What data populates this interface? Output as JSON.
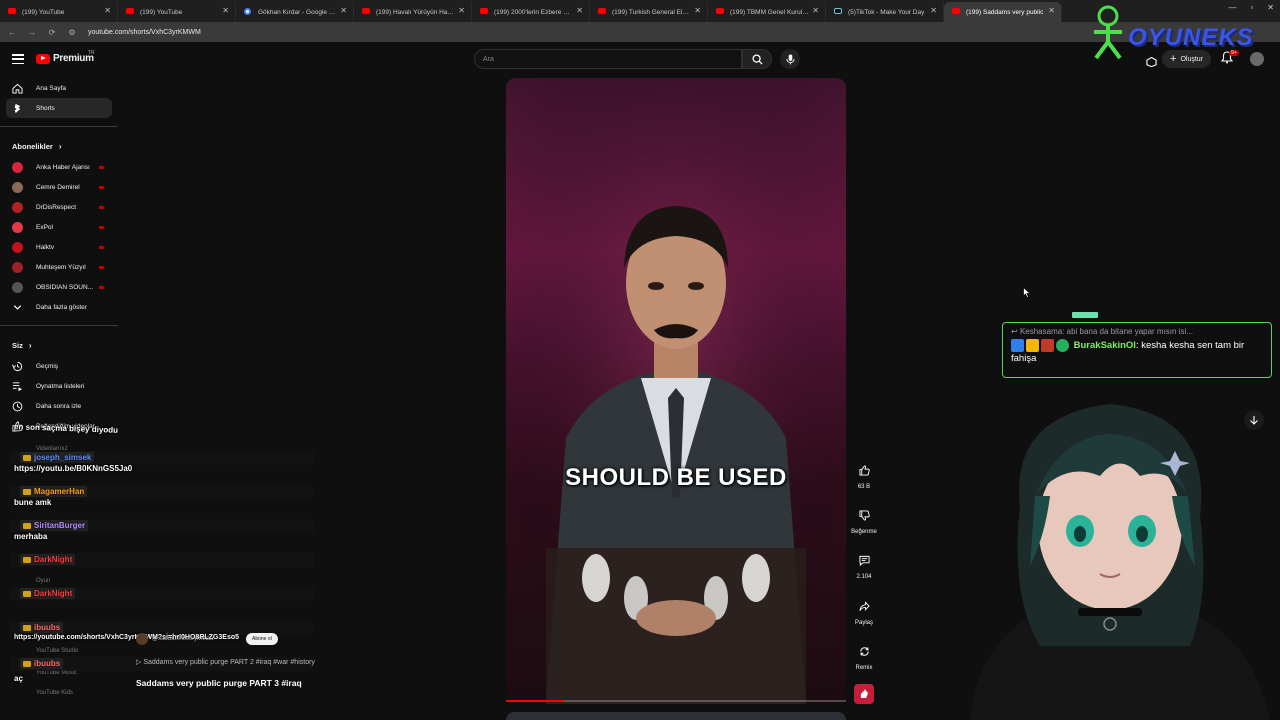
{
  "browser": {
    "tabs": [
      {
        "title": "(199) YouTube",
        "favicon": "yt"
      },
      {
        "title": "(199) YouTube",
        "favicon": "yt"
      },
      {
        "title": "Gökhan Kırdar - Google Search",
        "favicon": "google"
      },
      {
        "title": "(199) Havalı Yürüyün Havalı, Ka",
        "favicon": "yt"
      },
      {
        "title": "(199) 2000'lerin Ezbere Bilinen",
        "favicon": "yt"
      },
      {
        "title": "(199) Turkish General Election",
        "favicon": "yt"
      },
      {
        "title": "(199) TBMM Genel Kurulu 2024",
        "favicon": "yt"
      },
      {
        "title": "(5)TikTok - Make Your Day",
        "favicon": "tiktok"
      },
      {
        "title": "(199) Saddams very public",
        "favicon": "yt",
        "active": true
      }
    ],
    "url": "youtube.com/shorts/VxhC3yrKMWM"
  },
  "header": {
    "logo_text": "Premium",
    "logo_sup": "TR",
    "search_placeholder": "Ara",
    "create_label": "Oluştur",
    "notif_count": "9+"
  },
  "sidebar": {
    "main": [
      {
        "label": "Ana Sayfa",
        "icon": "home-icon"
      },
      {
        "label": "Shorts",
        "icon": "shorts-icon",
        "active": true
      }
    ],
    "subs_header": "Abonelikler",
    "subscriptions": [
      {
        "label": "Anka Haber Ajansı",
        "color": "#d7263d"
      },
      {
        "label": "Cemre Demirel",
        "color": "#8a6a5a"
      },
      {
        "label": "DrDisRespect",
        "color": "#b22222"
      },
      {
        "label": "ExPol",
        "color": "#e63946"
      },
      {
        "label": "Halktv",
        "color": "#c1121f"
      },
      {
        "label": "Muhteşem Yüzyıl",
        "color": "#9b2226"
      },
      {
        "label": "OBSIDIAN SOUN...",
        "color": "#555555"
      }
    ],
    "show_more": "Daha fazla göster",
    "you_header": "Siz",
    "you_items": [
      {
        "label": "Geçmiş",
        "icon": "history-icon"
      },
      {
        "label": "Oynatma listeleri",
        "icon": "playlist-icon"
      },
      {
        "label": "Daha sonra izle",
        "icon": "clock-icon"
      },
      {
        "label": "Beğendiğim videolar",
        "icon": "like-icon"
      }
    ]
  },
  "chat_overlay": {
    "messages": [
      {
        "type": "msg",
        "text": "en son saçma bişey diyodu"
      },
      {
        "type": "name",
        "text": "joseph_simsek",
        "color": "#5b8cff"
      },
      {
        "type": "msg",
        "text": "https://youtu.be/B0KNnGS5Ja0"
      },
      {
        "type": "name",
        "text": "MagamerHan",
        "color": "#ff9f1c"
      },
      {
        "type": "msg",
        "text": "bune amk"
      },
      {
        "type": "name",
        "text": "SiritanBurger",
        "color": "#b48cff"
      },
      {
        "type": "msg",
        "text": "merhaba"
      },
      {
        "type": "name",
        "text": "DarkNight",
        "color": "#ff3b3b"
      },
      {
        "type": "name",
        "text": "DarkNight",
        "color": "#ff3b3b"
      },
      {
        "type": "name",
        "text": "ibuubs",
        "color": "#ff6b6b"
      },
      {
        "type": "msg",
        "text": "https://youtube.com/shorts/VxhC3yrKMWM?si=hrI0HO8RLZG3Eso5"
      },
      {
        "type": "name",
        "text": "ibuubs",
        "color": "#ff6b6b"
      },
      {
        "type": "msg",
        "text": "aç"
      }
    ],
    "ghost": [
      "Videolarınız",
      "Oyun",
      "daha fazla",
      "YouTube Studio",
      "YouTube Music",
      "YouTube Kids"
    ]
  },
  "short": {
    "channel": "@saddamhistorymedia",
    "subscribe_label": "Abone ol",
    "subtitle": "Saddams very public purge PART 2 #iraq #war #history",
    "title": "Saddams very public purge PART 3 #iraq",
    "caption": "SHOULD BE USED",
    "progress_fraction": 0.17
  },
  "actions": [
    {
      "name": "like",
      "label": "63 B",
      "icon": "thumbs-up-icon"
    },
    {
      "name": "dislike",
      "label": "Beğenme",
      "icon": "thumbs-down-icon"
    },
    {
      "name": "comments",
      "label": "2.104",
      "icon": "comment-icon"
    },
    {
      "name": "share",
      "label": "Paylaş",
      "icon": "share-icon"
    },
    {
      "name": "remix",
      "label": "Remix",
      "icon": "remix-icon"
    }
  ],
  "stream_chat": {
    "reply_to": "Keshasama: abi bana da bitane yapar mısın isi...",
    "username": "BurakSakinOl",
    "message": "kesha kesha sen tam bir fahişa",
    "name_color": "#7cf05c"
  },
  "watermark": {
    "text": "OYUNEKS"
  }
}
